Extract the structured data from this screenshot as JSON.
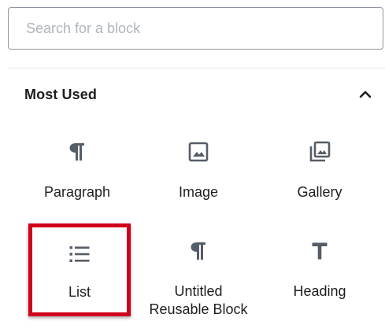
{
  "search": {
    "placeholder": "Search for a block",
    "value": ""
  },
  "panel": {
    "title": "Most Used",
    "expanded": true,
    "toggle_icon": "chevron-up-icon"
  },
  "blocks": [
    {
      "label": "Paragraph",
      "icon": "paragraph-icon"
    },
    {
      "label": "Image",
      "icon": "image-icon"
    },
    {
      "label": "Gallery",
      "icon": "gallery-icon"
    },
    {
      "label": "List",
      "icon": "list-icon",
      "highlighted": true
    },
    {
      "label": "Untitled Reusable Block",
      "icon": "paragraph-icon"
    },
    {
      "label": "Heading",
      "icon": "heading-icon"
    }
  ],
  "colors": {
    "highlight_border": "#d0021b",
    "icon": "#555d66",
    "text": "#1e1e1e",
    "placeholder": "#b0b5bb"
  }
}
